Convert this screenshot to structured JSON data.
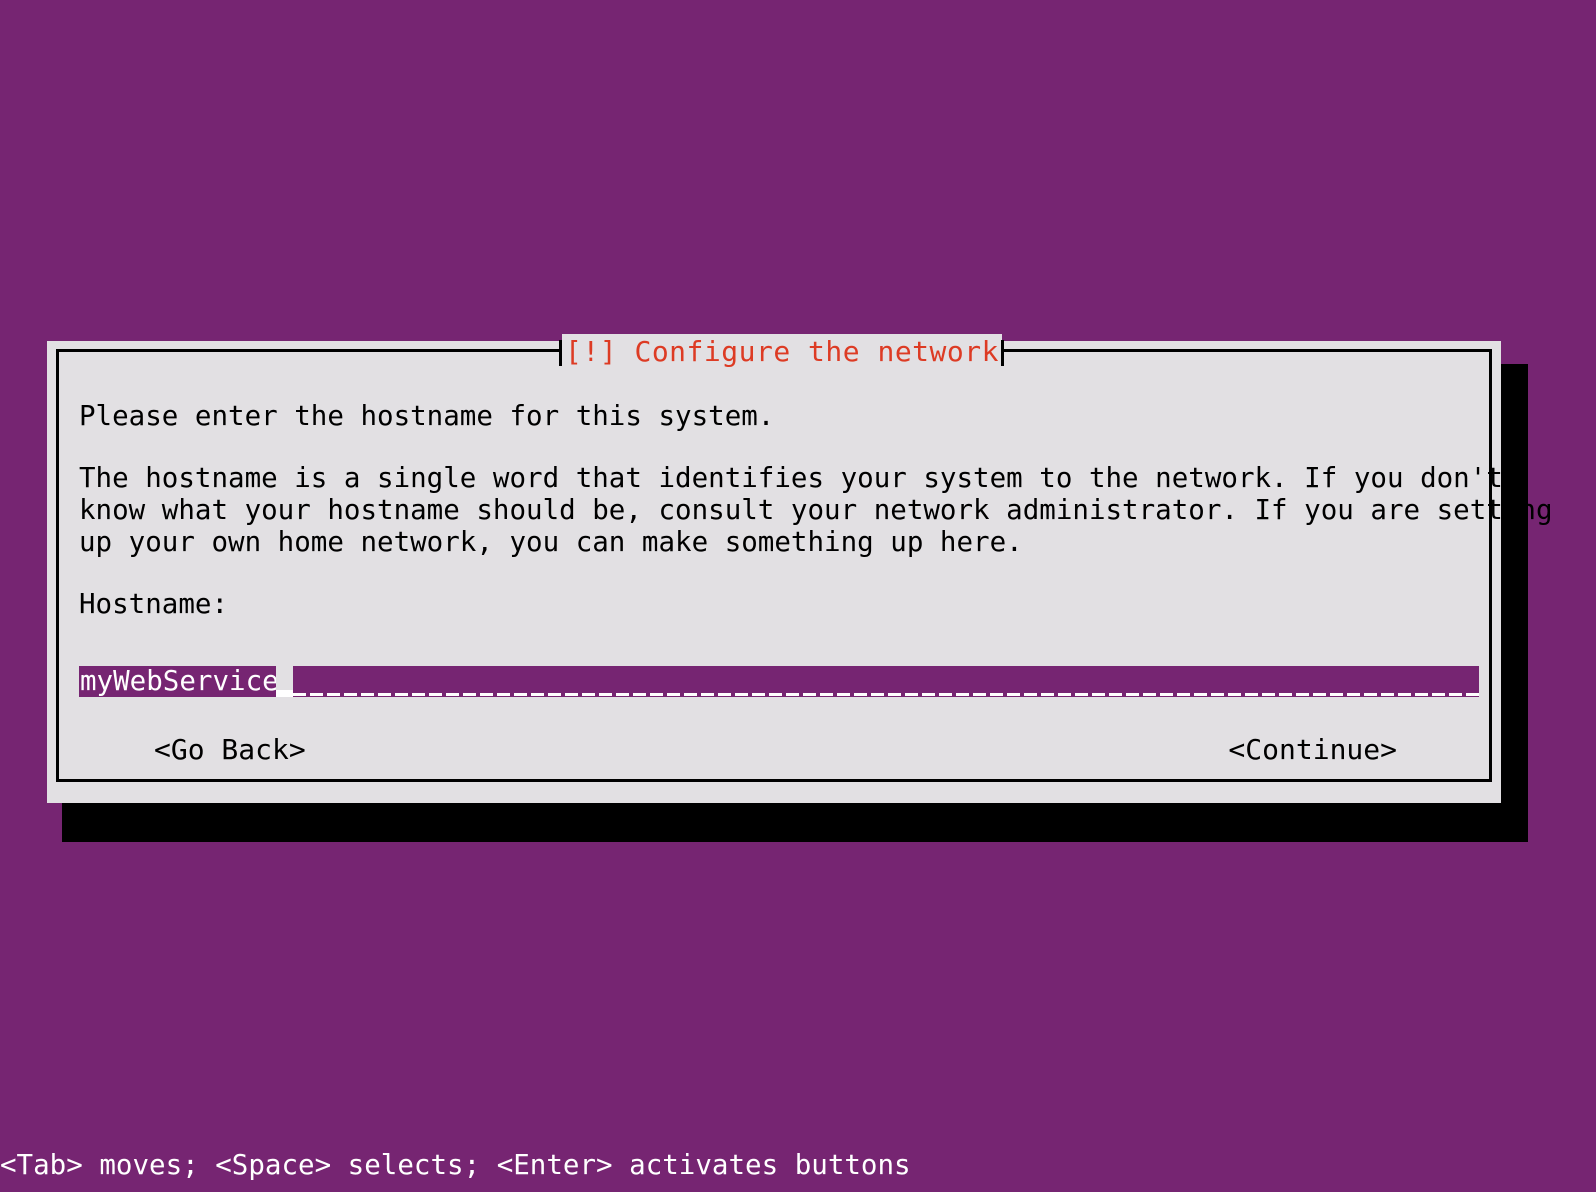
{
  "screen": {
    "background_color": "#762572",
    "foreground_color": "#ffffff"
  },
  "dialog": {
    "title": "[!] Configure the network",
    "title_color": "#dd3b24",
    "background_color": "#e2e0e3",
    "border_color": "#000000",
    "paragraphs": [
      "Please enter the hostname for this system.",
      "The hostname is a single word that identifies your system to the network. If you don't\nknow what your hostname should be, consult your network administrator. If you are setting\nup your own home network, you can make something up here."
    ],
    "paragraph_1": "Please enter the hostname for this system.",
    "paragraph_2_line_1": "The hostname is a single word that identifies your system to the network. If you don't",
    "paragraph_2_line_2": "know what your hostname should be, consult your network administrator. If you are setting",
    "paragraph_2_line_3": "up your own home network, you can make something up here.",
    "field": {
      "label": "Hostname:",
      "value": "myWebService",
      "placeholder": "",
      "field_background_color": "#762572",
      "field_text_color": "#ffffff"
    },
    "buttons": {
      "go_back": "<Go Back>",
      "continue": "<Continue>"
    }
  },
  "statusbar": {
    "hint": "<Tab> moves; <Space> selects; <Enter> activates buttons"
  }
}
